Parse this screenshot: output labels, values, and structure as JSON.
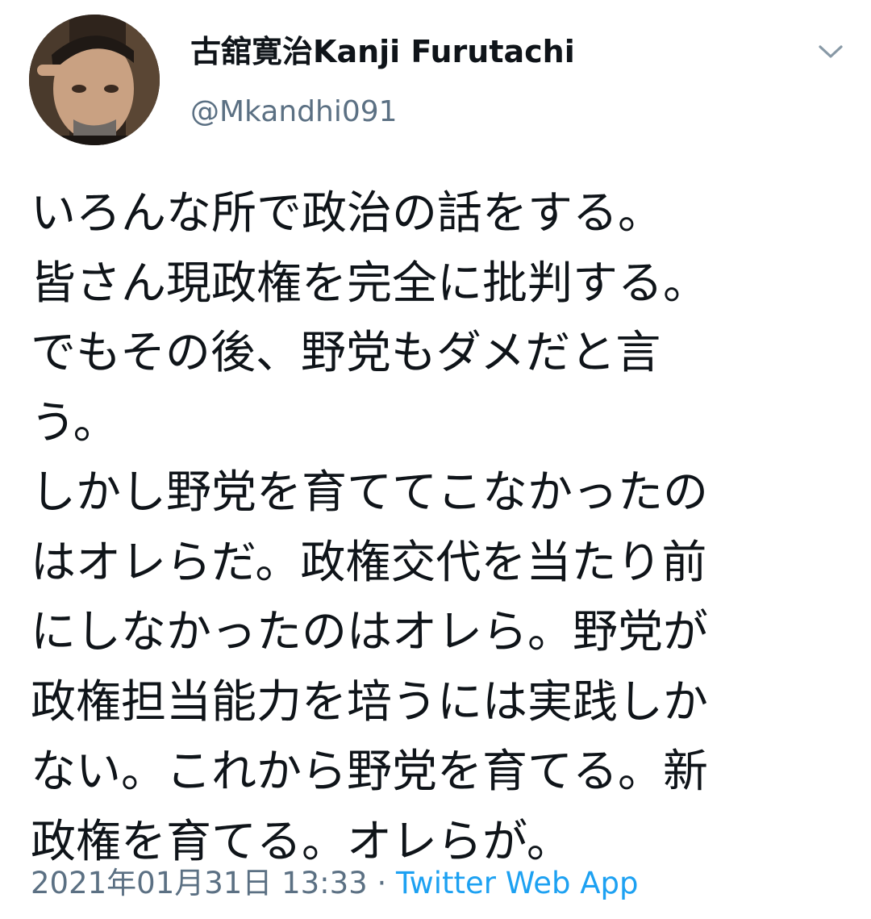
{
  "author": {
    "display_name": "古舘寛治Kanji Furutachi",
    "handle": "@Mkandhi091",
    "avatar_icon": "profile-photo"
  },
  "menu_icon": "chevron-down-icon",
  "tweet": {
    "lines": [
      "いろんな所で政治の話をする。",
      "皆さん現政権を完全に批判する。",
      "でもその後、野党もダメだと言",
      "う。",
      "しかし野党を育ててこなかったの",
      "はオレらだ。政権交代を当たり前",
      "にしなかったのはオレら。野党が",
      "政権担当能力を培うには実践しか",
      "ない。これから野党を育てる。新",
      "政権を育てる。オレらが。"
    ]
  },
  "meta": {
    "timestamp": "2021年01月31日 13:33",
    "separator": " · ",
    "source": "Twitter Web App"
  },
  "colors": {
    "text": "#0f1419",
    "secondary": "#5b7083",
    "link": "#1da1f2"
  }
}
